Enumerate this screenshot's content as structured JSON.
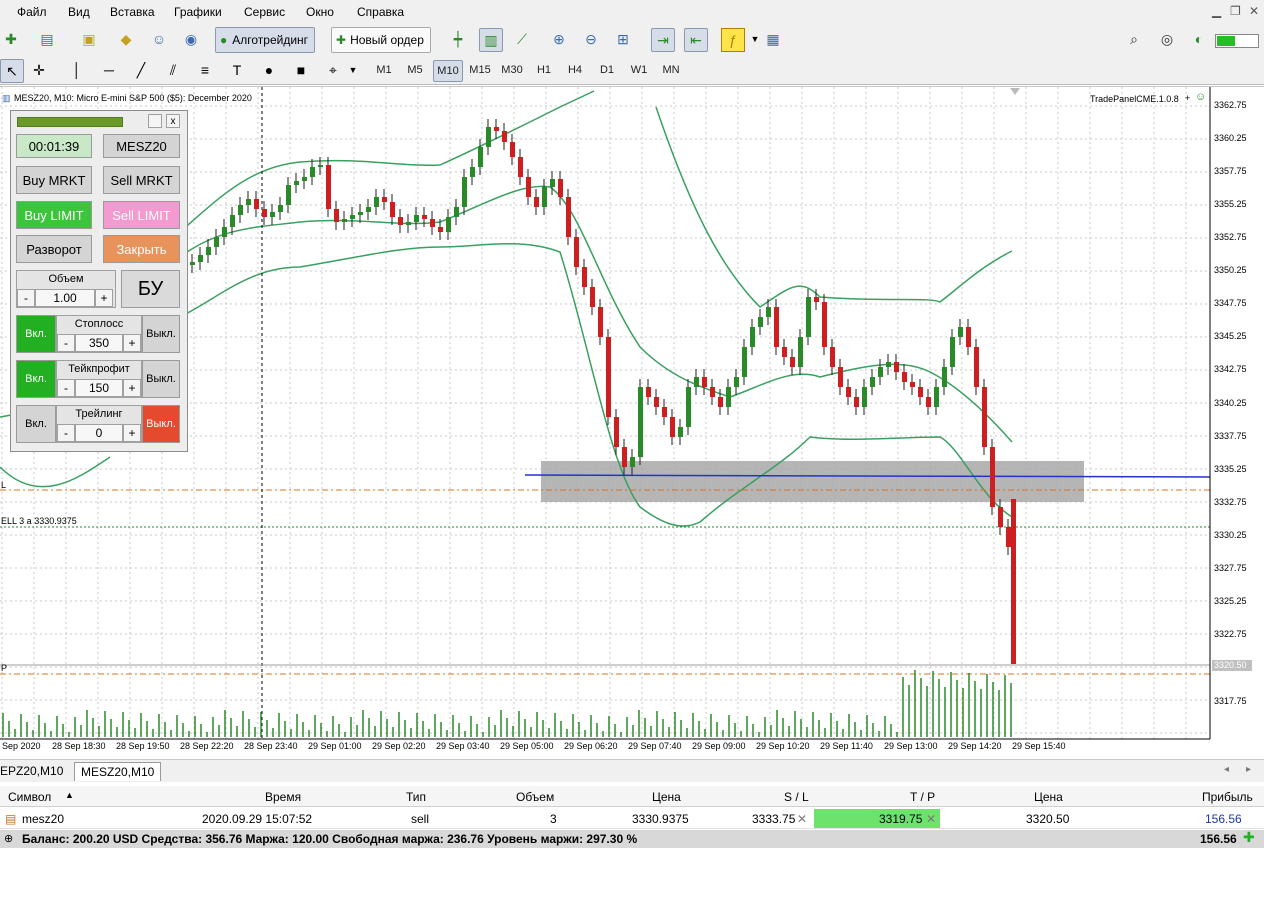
{
  "menu": [
    "Файл",
    "Вид",
    "Вставка",
    "Графики",
    "Сервис",
    "Окно",
    "Справка"
  ],
  "toolbar": {
    "algotrading_label": "Алготрейдинг",
    "new_order_label": "Новый ордер"
  },
  "timeframes": [
    "M1",
    "M5",
    "M10",
    "M15",
    "M30",
    "H1",
    "H4",
    "D1",
    "W1",
    "MN"
  ],
  "active_timeframe": "M10",
  "chart": {
    "title": "MESZ20, M10:  Micro E-mini S&P 500 ($5): December 2020",
    "indicator_label": "TradePanelCME.1.0.8",
    "price_labels": [
      "3362.75",
      "3360.25",
      "3357.75",
      "3355.25",
      "3352.75",
      "3350.25",
      "3347.75",
      "3345.25",
      "3342.75",
      "3340.25",
      "3337.75",
      "3335.25",
      "3332.75",
      "3330.25",
      "3327.75",
      "3325.25",
      "3322.75",
      "3320.50",
      "3317.75"
    ],
    "current_price": "3320.50",
    "time_labels": [
      "Sep 2020",
      "28 Sep 18:30",
      "28 Sep 19:50",
      "28 Sep 22:20",
      "28 Sep 23:40",
      "29 Sep 01:00",
      "29 Sep 02:20",
      "29 Sep 03:40",
      "29 Sep 05:00",
      "29 Sep 06:20",
      "29 Sep 07:40",
      "29 Sep 09:00",
      "29 Sep 10:20",
      "29 Sep 11:40",
      "29 Sep 13:00",
      "29 Sep 14:20",
      "29 Sep 15:40"
    ],
    "sell_line_label": "ELL 3 a 3330.9375",
    "left_marker_l": "L",
    "left_marker_p": "P"
  },
  "panel": {
    "timer": "00:01:39",
    "symbol": "MESZ20",
    "buy_market": "Buy MRKT",
    "sell_market": "Sell MRKT",
    "buy_limit": "Buy LIMIT",
    "sell_limit": "Sell LIMIT",
    "reverse": "Разворот",
    "close": "Закрыть",
    "volume_label": "Объем",
    "volume_value": "1.00",
    "breakeven": "БУ",
    "minus": "-",
    "plus": "+",
    "close_x": "x",
    "on": "Вкл.",
    "off": "Выкл.",
    "stoploss_label": "Стоплосс",
    "stoploss_value": "350",
    "takeprofit_label": "Тейкпрофит",
    "takeprofit_value": "150",
    "trailing_label": "Трейлинг",
    "trailing_value": "0"
  },
  "tabs": [
    "EPZ20,M10",
    "MESZ20,M10"
  ],
  "active_tab": "MESZ20,M10",
  "table": {
    "headers": [
      "Символ",
      "Время",
      "Тип",
      "Объем",
      "Цена",
      "S / L",
      "T / P",
      "Цена",
      "Прибыль"
    ],
    "row": {
      "symbol": "mesz20",
      "time": "2020.09.29 15:07:52",
      "type": "sell",
      "volume": "3",
      "price": "3330.9375",
      "sl": "3333.75",
      "tp": "3319.75",
      "current": "3320.50",
      "profit": "156.56"
    },
    "summary": "Баланс: 200.20 USD  Средства: 356.76  Маржа: 120.00  Свободная маржа: 236.76  Уровень маржи: 297.30 %",
    "summary_profit": "156.56"
  },
  "colors": {
    "bull": "#2a8a2a",
    "bear": "#cc1f1f",
    "bands": "#3aa060",
    "buy_limit_bg": "#3cc43c",
    "sell_limit_bg": "#f39ad0",
    "close_bg": "#e8925c",
    "on_bg": "#22b022",
    "off_red_bg": "#e64a2e",
    "tp_cell_bg": "#6de36d"
  }
}
